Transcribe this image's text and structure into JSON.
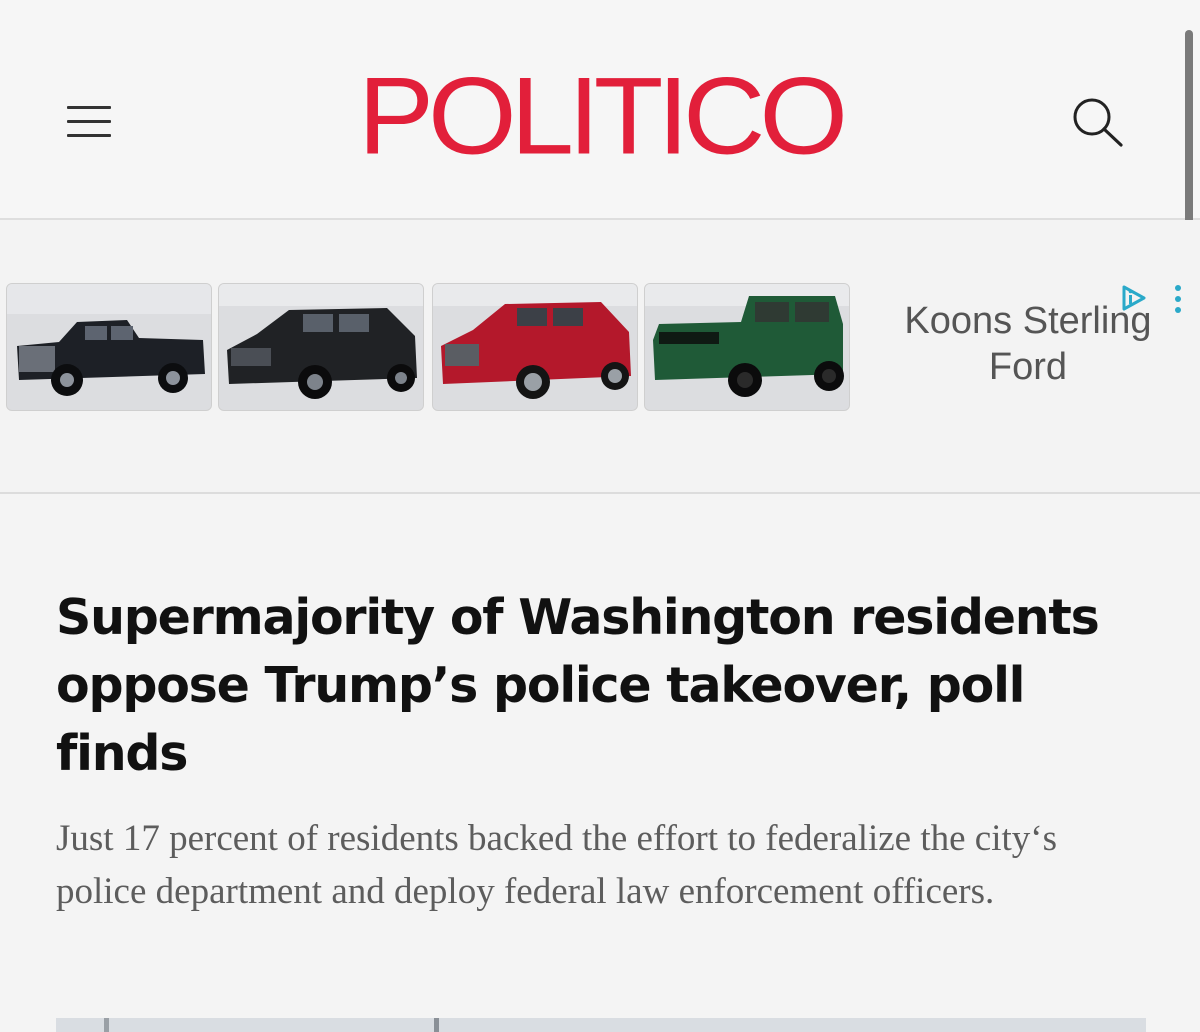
{
  "header": {
    "logo_text": "POLITICO",
    "menu_icon": "hamburger-menu-icon",
    "search_icon": "search-icon",
    "brand_color": "#e21f3a"
  },
  "ad": {
    "advertiser_line1": "Koons Sterling",
    "advertiser_line2": "Ford",
    "adchoices_icon": "adchoices-icon",
    "menu_icon": "vertical-dots-icon",
    "vehicles": [
      {
        "color": "#1d2026",
        "icon": "pickup-truck-image"
      },
      {
        "color": "#202225",
        "icon": "suv-image"
      },
      {
        "color": "#b4182b",
        "icon": "suv-image"
      },
      {
        "color": "#1f5a37",
        "icon": "suv-image"
      }
    ]
  },
  "article": {
    "headline": "Supermajority of Washington residents oppose Trump’s police takeover, poll finds",
    "dek": "Just 17 percent of residents backed the effort to federalize the city‘s police department and deploy federal law enforcement officers."
  }
}
